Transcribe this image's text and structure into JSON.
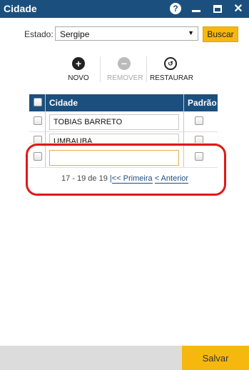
{
  "window": {
    "title": "Cidade"
  },
  "filter": {
    "estado_label": "Estado:",
    "estado_value": "Sergipe",
    "buscar_label": "Buscar"
  },
  "toolbar": {
    "novo_label": "NOVO",
    "remover_label": "REMOVER",
    "restaurar_label": "RESTAURAR"
  },
  "table": {
    "headers": {
      "cidade": "Cidade",
      "padrao": "Padrão"
    },
    "rows": [
      {
        "cidade": "TOBIAS BARRETO"
      },
      {
        "cidade": "UMBAUBA"
      },
      {
        "cidade": ""
      }
    ]
  },
  "pager": {
    "range_text": "17 - 19 de 19",
    "separator": "|",
    "first_label": "<< Primeira",
    "prev_label": "< Anterior"
  },
  "footer": {
    "salvar_label": "Salvar"
  },
  "colors": {
    "header_blue": "#1b4f7e",
    "accent_yellow": "#f6b80f",
    "highlight_red": "#e01818"
  }
}
